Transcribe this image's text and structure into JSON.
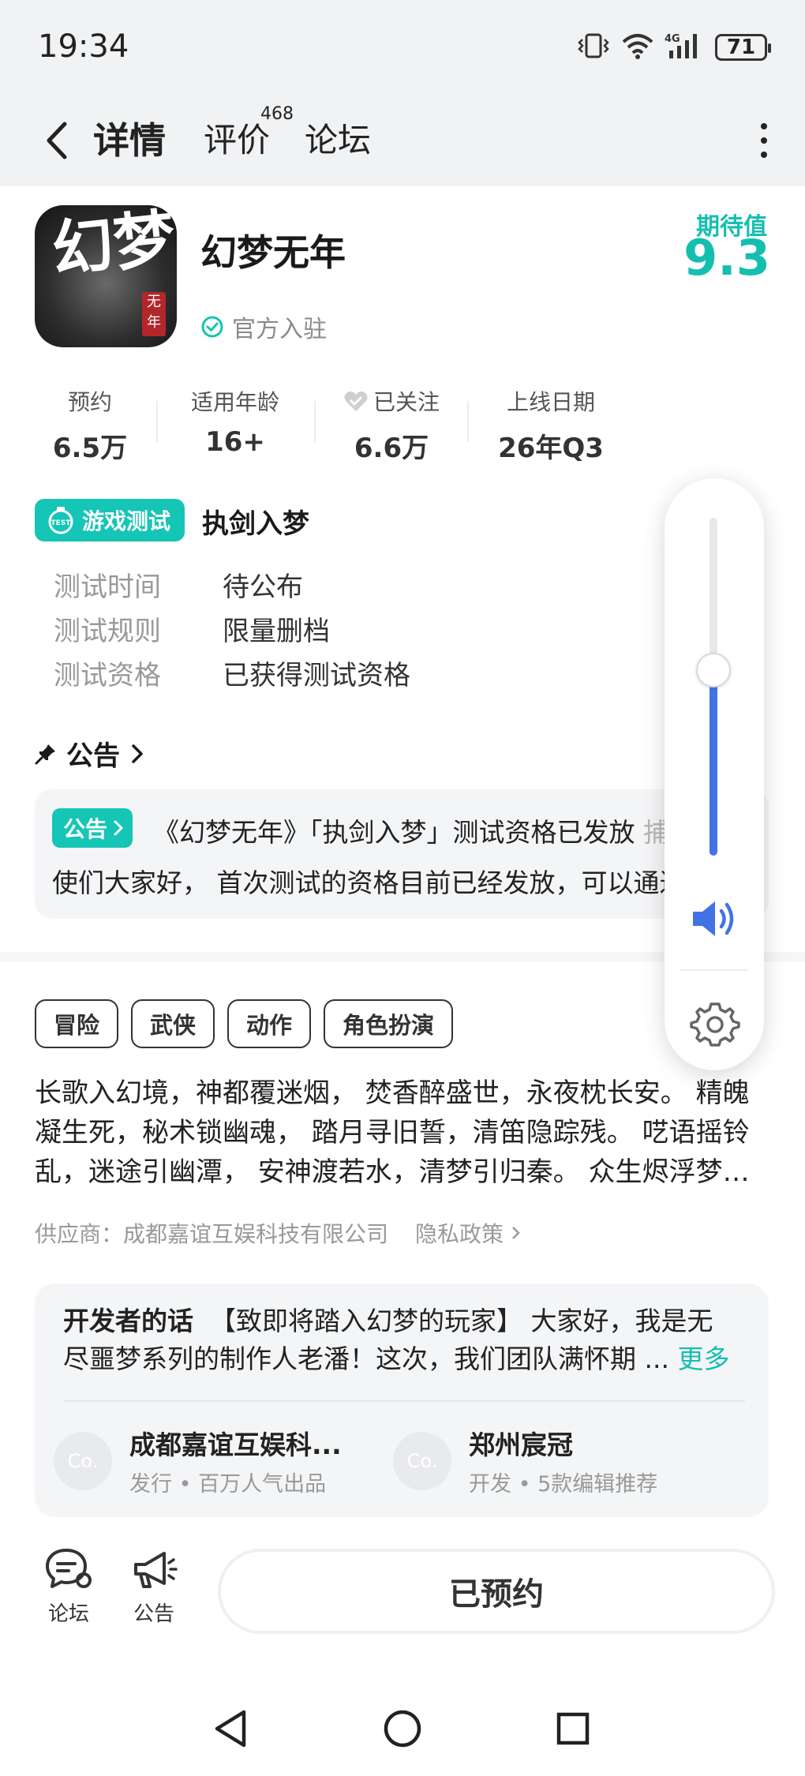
{
  "status_bar": {
    "time": "19:34",
    "battery": "71"
  },
  "nav": {
    "tabs": [
      {
        "label": "详情",
        "active": true
      },
      {
        "label": "评价",
        "badge": "468"
      },
      {
        "label": "论坛"
      }
    ]
  },
  "app": {
    "icon_text": "幻梦",
    "icon_seal": "无年",
    "name": "幻梦无年",
    "official_label": "官方入驻",
    "expectation_label": "期待值",
    "expectation_score": "9.3"
  },
  "stats": [
    {
      "label": "预约",
      "value": "6.5万"
    },
    {
      "label": "适用年龄",
      "value": "16+"
    },
    {
      "label": "已关注",
      "value": "6.6万"
    },
    {
      "label": "上线日期",
      "value": "26年Q3"
    }
  ],
  "test": {
    "badge": "游戏测试",
    "badge_icon_text": "TEST",
    "name": "执剑入梦",
    "rows": [
      {
        "label": "测试时间",
        "value": "待公布"
      },
      {
        "label": "测试规则",
        "value": "限量删档"
      },
      {
        "label": "测试资格",
        "value": "已获得测试资格"
      }
    ]
  },
  "notice": {
    "heading": "公告",
    "tag": "公告",
    "title": "《幻梦无年》「执剑入梦」测试资格已发放",
    "title_tail": "捕梦",
    "body": "使们大家好， 首次测试的资格目前已经发放，可以通过…"
  },
  "tags": [
    "冒险",
    "武侠",
    "动作",
    "角色扮演"
  ],
  "description": [
    "长歌入幻境，神都覆迷烟， 焚香醉盛世，永夜枕长安。 精魄",
    "凝生死，秘术锁幽魂， 踏月寻旧誓，清笛隐踪残。 呓语摇铃",
    "乱，迷途引幽潭， 安神渡若水，清梦引归秦。 众生烬浮梦…"
  ],
  "supplier": {
    "text": "供应商：成都嘉谊互娱科技有限公司",
    "privacy": "隐私政策"
  },
  "developer": {
    "heading": "开发者的话",
    "line1": "【致即将踏入幻梦的玩家】 大家好，我是无",
    "line2": "尽噩梦系列的制作人老潘！这次，我们团队满怀期 ...",
    "more": "更多",
    "companies": [
      {
        "avatar": "Co.",
        "name": "成都嘉谊互娱科...",
        "sub": "发行 • 百万人气出品"
      },
      {
        "avatar": "Co.",
        "name": "郑州宸冠",
        "sub": "开发 • 5款编辑推荐"
      }
    ]
  },
  "bottom_bar": {
    "forum": "论坛",
    "notice": "公告",
    "reserved": "已预约"
  },
  "volume": {
    "level_percent": 55,
    "accent": "#4273e5"
  },
  "colors": {
    "accent": "#15c5b5",
    "score": "#15bfb0"
  }
}
